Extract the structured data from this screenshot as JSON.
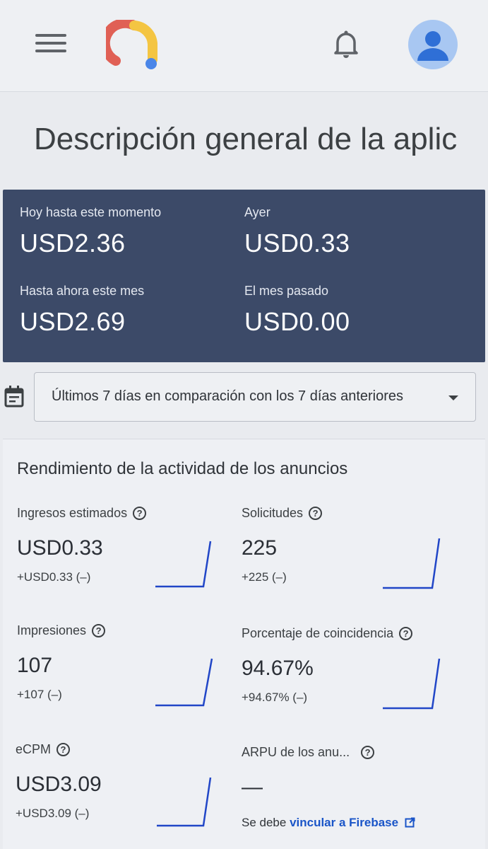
{
  "header": {
    "menu_icon": "menu-icon",
    "logo": "admob-logo",
    "notifications_icon": "bell-icon",
    "avatar_icon": "account-avatar-icon"
  },
  "page": {
    "title": "Descripción general de la aplic"
  },
  "summary": {
    "today_label": "Hoy hasta este momento",
    "today_value": "USD2.36",
    "yesterday_label": "Ayer",
    "yesterday_value": "USD0.33",
    "month_label": "Hasta ahora este mes",
    "month_value": "USD2.69",
    "last_month_label": "El mes pasado",
    "last_month_value": "USD0.00"
  },
  "date_range": {
    "calendar_icon": "calendar-icon",
    "label": "Últimos 7 días en comparación con los 7 días anteriores"
  },
  "performance": {
    "title": "Rendimiento de la actividad de los anuncios",
    "metrics": [
      {
        "label": "Ingresos estimados",
        "value": "USD0.33",
        "delta": "+USD0.33 (–)"
      },
      {
        "label": "Solicitudes",
        "value": "225",
        "delta": "+225 (–)"
      },
      {
        "label": "Impresiones",
        "value": "107",
        "delta": "+107 (–)"
      },
      {
        "label": "Porcentaje de coincidencia",
        "value": "94.67%",
        "delta": "+94.67% (–)"
      },
      {
        "label": "eCPM",
        "value": "USD3.09",
        "delta": "+USD3.09 (–)"
      },
      {
        "label": "ARPU de los anu...",
        "value": "—",
        "note_prefix": "Se debe ",
        "link_text": "vincular a Firebase"
      }
    ]
  },
  "colors": {
    "summary_bg": "#3c4a68",
    "sparkline": "#2146c7",
    "link": "#1a55c8"
  }
}
